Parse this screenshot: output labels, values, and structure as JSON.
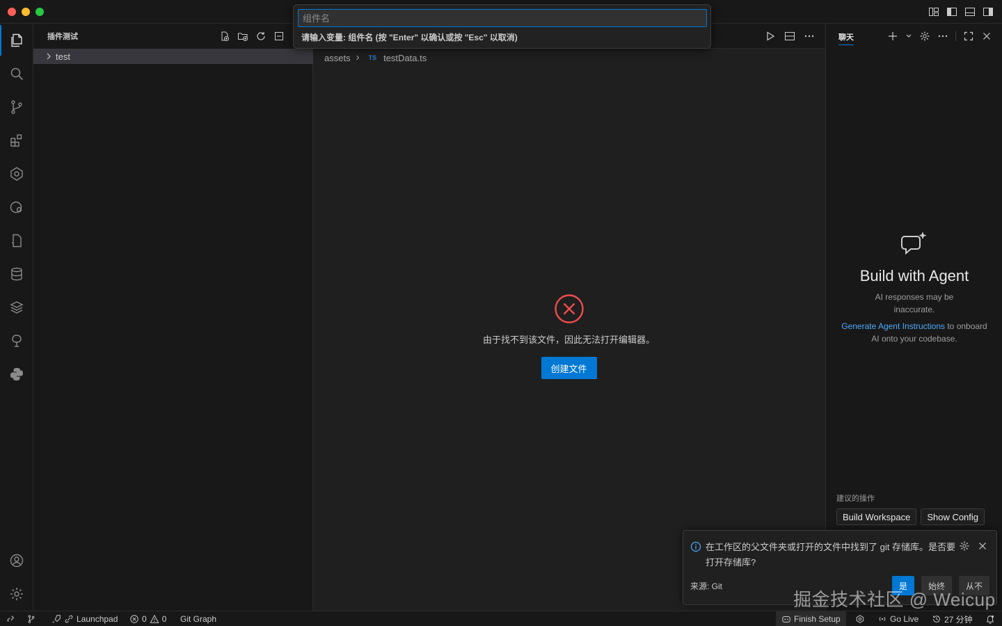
{
  "sidebar": {
    "title": "插件测试",
    "tree": [
      {
        "label": "test"
      }
    ]
  },
  "command_palette": {
    "placeholder": "组件名",
    "hint": "请输入变量: 组件名 (按 \"Enter\" 以确认或按 \"Esc\" 以取消)"
  },
  "editor": {
    "breadcrumb": {
      "folder": "assets",
      "file_badge": "TS",
      "file": "testData.ts"
    },
    "error_message": "由于找不到该文件，因此无法打开编辑器。",
    "create_button": "创建文件"
  },
  "chat": {
    "title": "聊天",
    "agent_title": "Build with Agent",
    "agent_subtitle": "AI responses may be inaccurate.",
    "agent_link": "Generate Agent Instructions",
    "agent_desc_rest": " to onboard AI onto your codebase.",
    "suggested_label": "建议的操作",
    "suggested_actions": [
      "Build Workspace",
      "Show Config"
    ]
  },
  "notification": {
    "message": "在工作区的父文件夹或打开的文件中找到了 git 存储库。是否要打开存储库?",
    "source": "来源: Git",
    "buttons": [
      "是",
      "始终",
      "从不"
    ]
  },
  "statusbar": {
    "launchpad": "Launchpad",
    "errors": "0",
    "warnings": "0",
    "git_graph": "Git Graph",
    "finish_setup": "Finish Setup",
    "go_live": "Go Live",
    "time": "27 分钟"
  },
  "watermark": "掘金技术社区 @ Weicup",
  "colors": {
    "accent": "#0078d4",
    "error": "#f14c4c",
    "link": "#4daafc"
  }
}
